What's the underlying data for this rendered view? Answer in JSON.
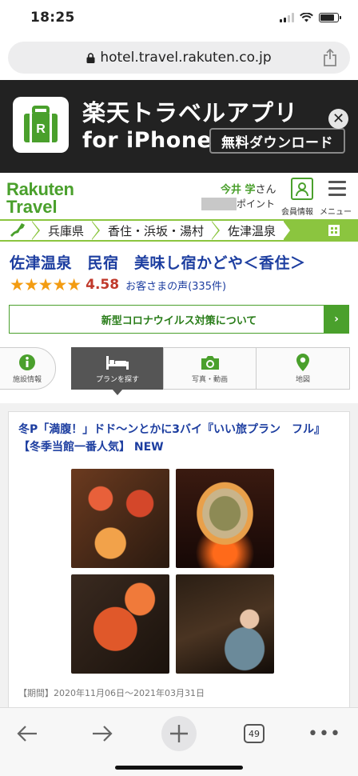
{
  "status_bar": {
    "time": "18:25"
  },
  "browser": {
    "url": "hotel.travel.rakuten.co.jp"
  },
  "app_banner": {
    "title": "楽天トラベルアプリ",
    "subtitle": "for iPhone",
    "download_label": "無料ダウンロード",
    "close_glyph": "✕"
  },
  "header": {
    "logo_line1": "Rakuten",
    "logo_line2": "Travel",
    "user_name": "今井 学",
    "user_suffix": "さん",
    "points_label": "ポイント",
    "member_label": "会員情報",
    "menu_label": "メニュー"
  },
  "breadcrumb": {
    "items": [
      "兵庫県",
      "香住・浜坂・湯村",
      "佐津温泉"
    ]
  },
  "hotel": {
    "name": "佐津温泉　民宿　美味し宿かどや＜香住＞",
    "stars": "★★★★★",
    "score": "4.58",
    "reviews": "お客さまの声(335件)"
  },
  "covid": {
    "label": "新型コロナウイルス対策について",
    "arrow": "›"
  },
  "tabs": [
    {
      "label": "施設情報",
      "icon": "info-icon"
    },
    {
      "label": "プランを探す",
      "icon": "bed-icon"
    },
    {
      "label": "写真・動画",
      "icon": "camera-icon"
    },
    {
      "label": "地図",
      "icon": "map-pin-icon"
    }
  ],
  "plan": {
    "title": "冬P「満腹！」ドド～ンとかに3バイ『いい旅プラン　フル』【冬季当館一番人気】 NEW",
    "period": "【期間】2020年11月06日～2021年03月31日"
  },
  "toolbar": {
    "tab_count": "49",
    "more": "•••"
  },
  "colors": {
    "brand_green": "#4aa02c",
    "breadcrumb_green": "#8bc53f",
    "link_blue": "#1d3ea0",
    "star_orange": "#f39c12",
    "score_red": "#c0392b"
  }
}
